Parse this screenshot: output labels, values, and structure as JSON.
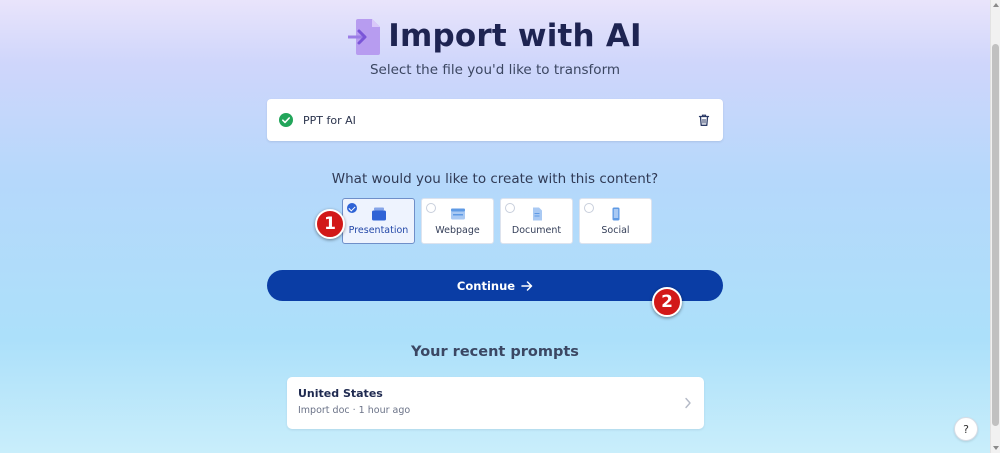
{
  "header": {
    "title": "Import with AI",
    "subtitle": "Select the file you'd like to transform",
    "icon": "import-doc-icon"
  },
  "file": {
    "name": "PPT for AI",
    "status_icon": "check-circle-icon",
    "delete_icon": "trash-icon",
    "status_color": "#22a55a"
  },
  "question": "What would you like to create with this content?",
  "options": [
    {
      "label": "Presentation",
      "icon": "presentation-icon",
      "selected": true
    },
    {
      "label": "Webpage",
      "icon": "webpage-icon",
      "selected": false
    },
    {
      "label": "Document",
      "icon": "document-icon",
      "selected": false
    },
    {
      "label": "Social",
      "icon": "phone-icon",
      "selected": false
    }
  ],
  "step_badges": [
    "1",
    "2"
  ],
  "continue_label": "Continue",
  "recent": {
    "title": "Your recent prompts",
    "items": [
      {
        "name": "United States",
        "meta": "Import doc · 1 hour ago"
      }
    ]
  },
  "help_label": "?",
  "colors": {
    "accent": "#0a3da5",
    "title": "#1e2452",
    "badge": "#d21818",
    "selected_radio": "#2f63d6"
  }
}
